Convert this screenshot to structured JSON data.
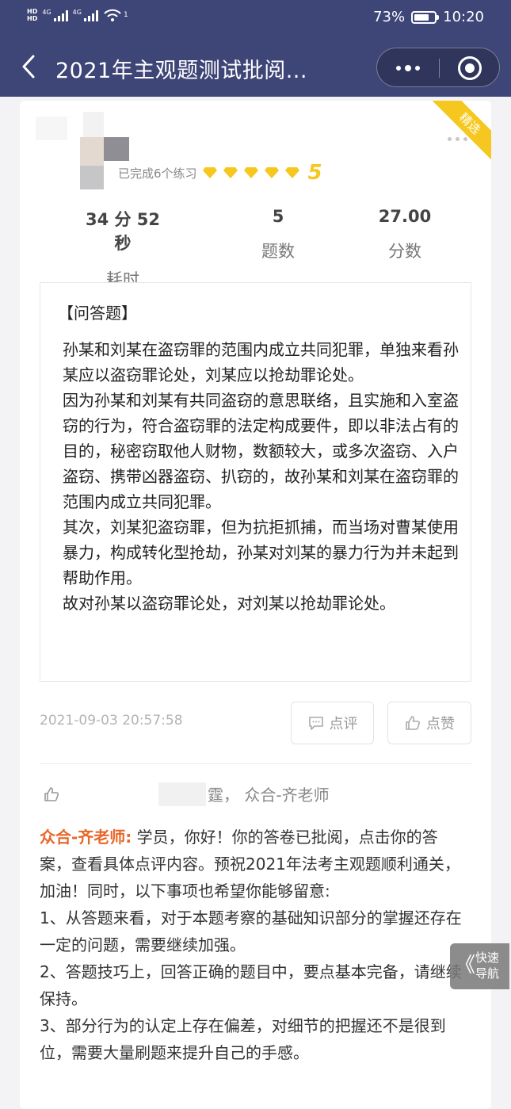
{
  "status_bar": {
    "network_a": "4G",
    "network_b": "4G",
    "wifi_sup": "1",
    "battery_pct": "73%",
    "battery_level": 0.73,
    "time": "10:20"
  },
  "nav": {
    "title": "2021年主观题测试批阅..."
  },
  "card": {
    "ribbon": "精选",
    "completed_text": "已完成6个练习",
    "level": "5",
    "diamond_count": 5,
    "diamond_color": "#f6c81f",
    "stats": [
      {
        "value": "34 分 52 秒",
        "label": "耗时"
      },
      {
        "value": "5",
        "label": "题数"
      },
      {
        "value": "27.00",
        "label": "分数"
      }
    ],
    "answer": {
      "tag": "【问答题】",
      "body": "孙某和刘某在盗窃罪的范围内成立共同犯罪，单独来看孙某应以盗窃罪论处，刘某应以抢劫罪论处。\n因为孙某和刘某有共同盗窃的意思联络，且实施和入室盗窃的行为，符合盗窃罪的法定构成要件，即以非法占有的目的，秘密窃取他人财物，数额较大，或多次盗窃、入户盗窃、携带凶器盗窃、扒窃的，故孙某和刘某在盗窃罪的范围内成立共同犯罪。\n其次，刘某犯盗窃罪，但为抗拒抓捕，而当场对曹某使用暴力，构成转化型抢劫，孙某对刘某的暴力行为并未起到帮助作用。\n故对孙某以盗窃罪论处，对刘某以抢劫罪论处。"
    },
    "timestamp": "2021-09-03 20:57:58",
    "comment_btn": "点评",
    "like_btn": "点赞",
    "likers": "霆， 众合-齐老师",
    "comment": {
      "author": "众合-齐老师:",
      "text": " 学员，你好！你的答卷已批阅，点击你的答案，查看具体点评内容。预祝2021年法考主观题顺利通关，加油！同时，以下事项也希望你能够留意:\n1、从答题来看，对于本题考察的基础知识部分的掌握还存在一定的问题，需要继续加强。\n2、答题技巧上，回答正确的题目中，要点基本完备，请继续保持。\n3、部分行为的认定上存在偏差，对细节的把握还不是很到位，需要大量刷题来提升自己的手感。"
    }
  },
  "fab": {
    "arrow": "《",
    "label": "快速导航"
  },
  "colors": {
    "header_bg": "#3e4577",
    "accent_orange": "#e8672a",
    "gold": "#f6c81f"
  }
}
